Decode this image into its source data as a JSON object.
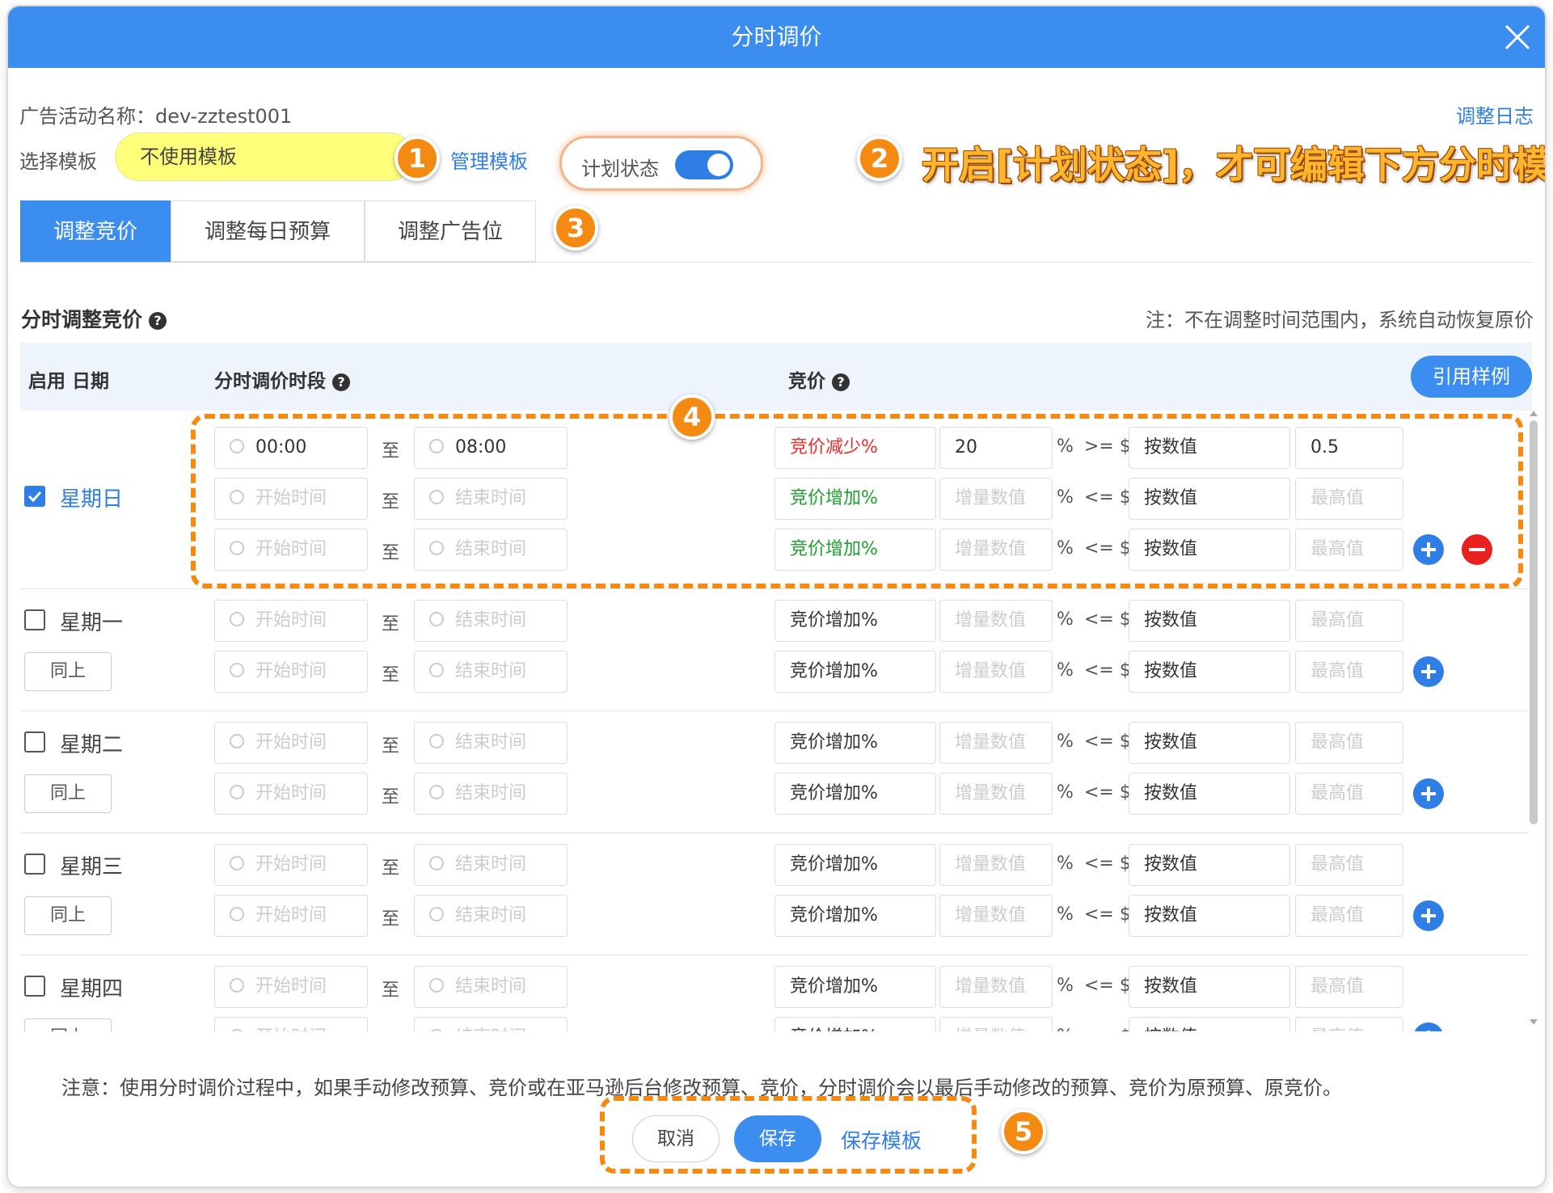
{
  "dialog": {
    "title": "分时调价"
  },
  "header": {
    "campaign_label": "广告活动名称：",
    "campaign_name": "dev-zztest001",
    "adjust_log": "调整日志",
    "template_label": "选择模板",
    "template_value": "不使用模板",
    "manage_template": "管理模板",
    "plan_status_label": "计划状态",
    "plan_status_on": true
  },
  "annotations": {
    "b1": "1",
    "b2": "2",
    "b3": "3",
    "b4": "4",
    "b5": "5",
    "hint": "开启[计划状态]，才可编辑下方分时模板",
    "accent": "#f58a12"
  },
  "tabs": [
    {
      "label": "调整竞价",
      "active": true
    },
    {
      "label": "调整每日预算",
      "active": false
    },
    {
      "label": "调整广告位",
      "active": false
    }
  ],
  "section": {
    "title": "分时调整竞价",
    "note": "注：不在调整时间范围内，系统自动恢复原价"
  },
  "table_header": {
    "col_enable_date": "启用 日期",
    "col_period": "分时调价时段",
    "col_bid": "竞价",
    "example_button": "引用样例"
  },
  "labels": {
    "to": "至",
    "percent": "%",
    "same_as_above": "同上"
  },
  "days": [
    {
      "name": "星期日",
      "checked": true,
      "same_button": false,
      "rows": [
        {
          "start": "00:00",
          "end": "08:00",
          "type": "竞价减少%",
          "type_color": "red",
          "amount": "20",
          "cmp": ">= $",
          "mode": "按数值",
          "limit": "0.5",
          "plus": false,
          "minus": false
        },
        {
          "start": "开始时间",
          "end": "结束时间",
          "type": "竞价增加%",
          "type_color": "green",
          "amount": "增量数值",
          "cmp": "<= $",
          "mode": "按数值",
          "limit": "最高值",
          "plus": false,
          "minus": false
        },
        {
          "start": "开始时间",
          "end": "结束时间",
          "type": "竞价增加%",
          "type_color": "green",
          "amount": "增量数值",
          "cmp": "<= $",
          "mode": "按数值",
          "limit": "最高值",
          "plus": true,
          "minus": true
        }
      ]
    },
    {
      "name": "星期一",
      "checked": false,
      "same_button": true,
      "rows": [
        {
          "start": "开始时间",
          "end": "结束时间",
          "type": "竞价增加%",
          "type_color": "normal",
          "amount": "增量数值",
          "cmp": "<= $",
          "mode": "按数值",
          "limit": "最高值",
          "plus": false,
          "minus": false
        },
        {
          "start": "开始时间",
          "end": "结束时间",
          "type": "竞价增加%",
          "type_color": "normal",
          "amount": "增量数值",
          "cmp": "<= $",
          "mode": "按数值",
          "limit": "最高值",
          "plus": true,
          "minus": false
        }
      ]
    },
    {
      "name": "星期二",
      "checked": false,
      "same_button": true,
      "rows": [
        {
          "start": "开始时间",
          "end": "结束时间",
          "type": "竞价增加%",
          "type_color": "normal",
          "amount": "增量数值",
          "cmp": "<= $",
          "mode": "按数值",
          "limit": "最高值",
          "plus": false,
          "minus": false
        },
        {
          "start": "开始时间",
          "end": "结束时间",
          "type": "竞价增加%",
          "type_color": "normal",
          "amount": "增量数值",
          "cmp": "<= $",
          "mode": "按数值",
          "limit": "最高值",
          "plus": true,
          "minus": false
        }
      ]
    },
    {
      "name": "星期三",
      "checked": false,
      "same_button": true,
      "rows": [
        {
          "start": "开始时间",
          "end": "结束时间",
          "type": "竞价增加%",
          "type_color": "normal",
          "amount": "增量数值",
          "cmp": "<= $",
          "mode": "按数值",
          "limit": "最高值",
          "plus": false,
          "minus": false
        },
        {
          "start": "开始时间",
          "end": "结束时间",
          "type": "竞价增加%",
          "type_color": "normal",
          "amount": "增量数值",
          "cmp": "<= $",
          "mode": "按数值",
          "limit": "最高值",
          "plus": true,
          "minus": false
        }
      ]
    },
    {
      "name": "星期四",
      "checked": false,
      "same_button": true,
      "rows": [
        {
          "start": "开始时间",
          "end": "结束时间",
          "type": "竞价增加%",
          "type_color": "normal",
          "amount": "增量数值",
          "cmp": "<= $",
          "mode": "按数值",
          "limit": "最高值",
          "plus": false,
          "minus": false
        },
        {
          "start": "开始时间",
          "end": "结束时间",
          "type": "竞价增加%",
          "type_color": "normal",
          "amount": "增量数值",
          "cmp": "<= $",
          "mode": "按数值",
          "limit": "最高值",
          "plus": true,
          "minus": false
        }
      ]
    }
  ],
  "footer": {
    "note": "注意：使用分时调价过程中，如果手动修改预算、竞价或在亚马逊后台修改预算、竞价，分时调价会以最后手动修改的预算、竞价为原预算、原竞价。",
    "cancel": "取消",
    "save": "保存",
    "save_template": "保存模板"
  },
  "icons": {
    "close": "close-icon",
    "help": "question-circle-icon",
    "clock": "clock-icon",
    "add": "plus-circle-icon",
    "remove": "minus-circle-icon",
    "check": "checkmark-icon"
  },
  "colors": {
    "primary": "#3b8df0",
    "decrease": "#ee2b2b",
    "increase": "#1e9e2b",
    "template_highlight": "#ffff7a"
  }
}
